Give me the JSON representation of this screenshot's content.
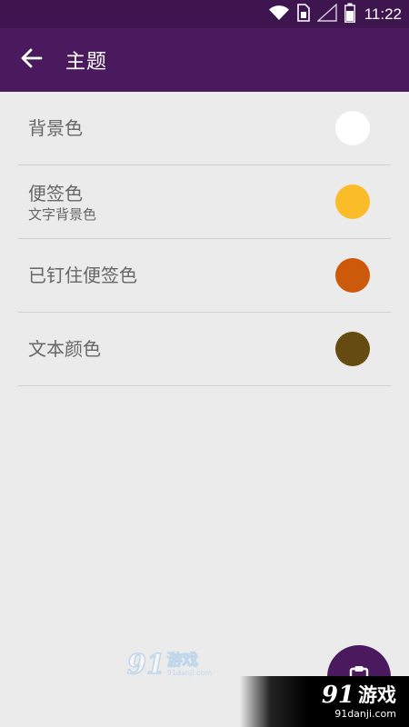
{
  "status_bar": {
    "time": "11:22",
    "icons": [
      "wifi-icon",
      "sim-card-icon",
      "signal-icon",
      "battery-icon"
    ]
  },
  "app_bar": {
    "title": "主题",
    "back_icon": "arrow-left-icon",
    "background": "#4b1a5e"
  },
  "settings": [
    {
      "label": "背景色",
      "sublabel": "",
      "color": "#ffffff"
    },
    {
      "label": "便签色",
      "sublabel": "文字背景色",
      "color": "#fbbc2a"
    },
    {
      "label": "已钉住便签色",
      "sublabel": "",
      "color": "#cd5a0b"
    },
    {
      "label": "文本颜色",
      "sublabel": "",
      "color": "#654a11"
    }
  ],
  "fab": {
    "icon": "clipboard-icon"
  },
  "watermark_center": {
    "logo": "91",
    "text": "游戏",
    "url": "91danji.com"
  },
  "watermark_corner": {
    "logo": "91",
    "text": "游戏",
    "url": "91danji.com"
  }
}
